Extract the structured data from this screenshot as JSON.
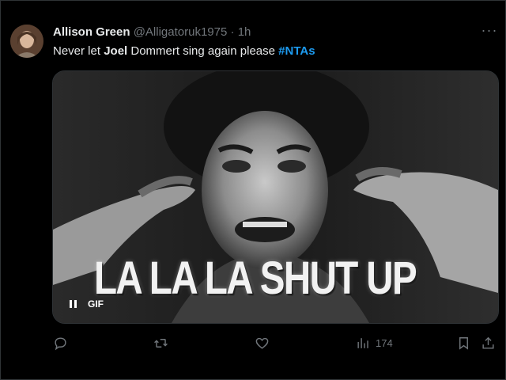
{
  "tweet": {
    "author_name": "Allison Green",
    "handle": "@Alligatoruk1975",
    "separator": "·",
    "time": "1h",
    "more_label": "···",
    "text_before": "Never let ",
    "text_bold": "Joel",
    "text_middle": " Dommert sing again please ",
    "hashtag": "#NTAs"
  },
  "media": {
    "caption": "LA LA LA SHUT UP",
    "badge": "GIF"
  },
  "actions": {
    "views": "174"
  },
  "colors": {
    "background": "#000000",
    "text": "#e7e9ea",
    "muted": "#71767b",
    "link": "#1d9bf0",
    "border": "#2f3336"
  },
  "icons": [
    "more-icon",
    "reply-icon",
    "retweet-icon",
    "like-icon",
    "views-icon",
    "bookmark-icon",
    "share-icon",
    "pause-icon"
  ]
}
